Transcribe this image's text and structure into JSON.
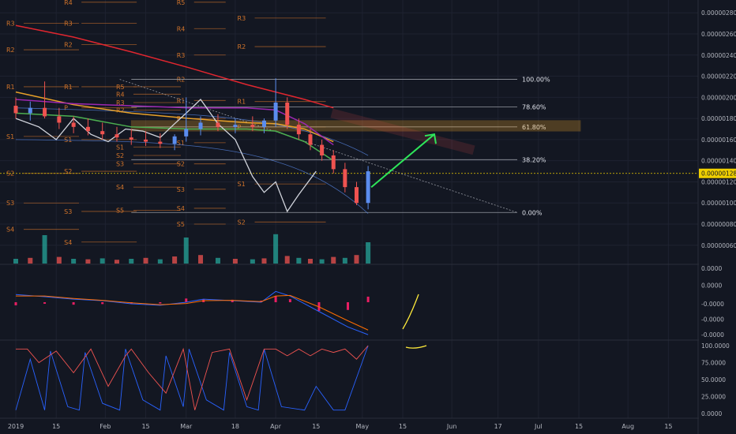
{
  "colors": {
    "background": "#131722",
    "grid": "#1e2230",
    "axis_text": "#b2b5be",
    "pivot": "#d0732a",
    "fib": "#9598a1",
    "bull": "#26a69a",
    "bear": "#ef5350",
    "highlight": "#f0d000",
    "projection": "#2ee65a",
    "ma200": "#e0262f",
    "ma100": "#e8a128",
    "ma50": "#4caf50",
    "ma_purple": "#9c27b0",
    "bollinger": "#5b8def",
    "comparison_line": "#d1d4dc",
    "macd_line": "#2962ff",
    "signal_line": "#ff6d00",
    "hist": "#e91e63",
    "stoch_k": "#2962ff",
    "stoch_d": "#ef5350",
    "drawing_yellow": "#ffeb3b"
  },
  "chart_data": [
    {
      "type": "line",
      "panel": "price",
      "title": "",
      "x_tick_labels": [
        "2019",
        "15",
        "Feb",
        "15",
        "Mar",
        "18",
        "Apr",
        "15",
        "May",
        "15",
        "Jun",
        "17",
        "Jul",
        "15",
        "Aug",
        "15"
      ],
      "x_tick_days": [
        0,
        14,
        31,
        45,
        59,
        76,
        90,
        104,
        120,
        134,
        151,
        167,
        181,
        195,
        212,
        226
      ],
      "y_tick_labels": [
        "0.00000060",
        "0.00000080",
        "0.00000100",
        "0.00000120",
        "0.00000140",
        "0.00000160",
        "0.00000180",
        "0.00000200",
        "0.00000220",
        "0.00000240",
        "0.00000260",
        "0.00000280"
      ],
      "ylim": [
        5e-07,
        2.9e-06
      ],
      "last_price": "0.00000128",
      "fib_levels": [
        {
          "label": "100.00%",
          "value": 2.17e-06
        },
        {
          "label": "78.60%",
          "value": 1.91e-06
        },
        {
          "label": "61.80%",
          "value": 1.72e-06
        },
        {
          "label": "38.20%",
          "value": 1.41e-06
        },
        {
          "label": "0.00%",
          "value": 9.1e-07
        }
      ],
      "pivot_labels": [
        {
          "label": "R4",
          "day": 20,
          "value": 2.9e-06
        },
        {
          "label": "R3",
          "day": 0,
          "value": 2.7e-06
        },
        {
          "label": "R3",
          "day": 20,
          "value": 2.7e-06
        },
        {
          "label": "R2",
          "day": 0,
          "value": 2.45e-06
        },
        {
          "label": "R2",
          "day": 20,
          "value": 2.5e-06
        },
        {
          "label": "R1",
          "day": 0,
          "value": 2.1e-06
        },
        {
          "label": "R1",
          "day": 20,
          "value": 2.1e-06
        },
        {
          "label": "P",
          "day": 20,
          "value": 1.9e-06
        },
        {
          "label": "S1",
          "day": 0,
          "value": 1.63e-06
        },
        {
          "label": "S1",
          "day": 20,
          "value": 1.6e-06
        },
        {
          "label": "S2",
          "day": 0,
          "value": 1.28e-06
        },
        {
          "label": "S2",
          "day": 20,
          "value": 1.3e-06
        },
        {
          "label": "S3",
          "day": 0,
          "value": 1e-06
        },
        {
          "label": "S3",
          "day": 20,
          "value": 9.2e-07
        },
        {
          "label": "S4",
          "day": 0,
          "value": 7.5e-07
        },
        {
          "label": "S4",
          "day": 20,
          "value": 6.3e-07
        },
        {
          "label": "R5",
          "day": 38,
          "value": 2.1e-06
        },
        {
          "label": "R4",
          "day": 38,
          "value": 2.03e-06
        },
        {
          "label": "R3",
          "day": 38,
          "value": 1.95e-06
        },
        {
          "label": "R2",
          "day": 38,
          "value": 1.88e-06
        },
        {
          "label": "S1",
          "day": 38,
          "value": 1.53e-06
        },
        {
          "label": "S2",
          "day": 38,
          "value": 1.45e-06
        },
        {
          "label": "S3",
          "day": 38,
          "value": 1.37e-06
        },
        {
          "label": "S4",
          "day": 38,
          "value": 1.15e-06
        },
        {
          "label": "S5",
          "day": 38,
          "value": 9.3e-07
        },
        {
          "label": "R5",
          "day": 59,
          "value": 2.9e-06
        },
        {
          "label": "R4",
          "day": 59,
          "value": 2.65e-06
        },
        {
          "label": "R3",
          "day": 59,
          "value": 2.4e-06
        },
        {
          "label": "R2",
          "day": 59,
          "value": 2.17e-06
        },
        {
          "label": "R1",
          "day": 59,
          "value": 1.97e-06
        },
        {
          "label": "P",
          "day": 59,
          "value": 1.8e-06
        },
        {
          "label": "S1",
          "day": 59,
          "value": 1.57e-06
        },
        {
          "label": "S2",
          "day": 59,
          "value": 1.37e-06
        },
        {
          "label": "S3",
          "day": 59,
          "value": 1.13e-06
        },
        {
          "label": "S4",
          "day": 59,
          "value": 9.5e-07
        },
        {
          "label": "S5",
          "day": 59,
          "value": 8e-07
        },
        {
          "label": "R3",
          "day": 80,
          "value": 2.75e-06
        },
        {
          "label": "R2",
          "day": 80,
          "value": 2.48e-06
        },
        {
          "label": "R1",
          "day": 80,
          "value": 1.96e-06
        },
        {
          "label": "P",
          "day": 80,
          "value": 1.72e-06
        },
        {
          "label": "S1",
          "day": 80,
          "value": 1.18e-06
        },
        {
          "label": "S2",
          "day": 80,
          "value": 8.2e-07
        }
      ],
      "series": [
        {
          "name": "",
          "kind": "ma",
          "color_key": "ma200",
          "x": [
            0,
            20,
            40,
            60,
            80,
            90,
            100,
            110
          ],
          "y": [
            2.68e-06,
            2.57e-06,
            2.43e-06,
            2.28e-06,
            2.12e-06,
            2.05e-06,
            1.98e-06,
            1.9e-06
          ]
        },
        {
          "name": "",
          "kind": "ma",
          "color_key": "ma100",
          "x": [
            0,
            20,
            40,
            60,
            80,
            90,
            100,
            110
          ],
          "y": [
            2.05e-06,
            1.93e-06,
            1.85e-06,
            1.8e-06,
            1.76e-06,
            1.75e-06,
            1.7e-06,
            1.58e-06
          ]
        },
        {
          "name": "",
          "kind": "ma",
          "color_key": "ma50",
          "x": [
            0,
            20,
            40,
            60,
            80,
            90,
            100,
            110
          ],
          "y": [
            1.85e-06,
            1.82e-06,
            1.72e-06,
            1.7e-06,
            1.7e-06,
            1.68e-06,
            1.58e-06,
            1.4e-06
          ]
        },
        {
          "name": "",
          "kind": "ma",
          "color_key": "ma_purple",
          "x": [
            0,
            20,
            40,
            60,
            80,
            90,
            100,
            110
          ],
          "y": [
            1.98e-06,
            1.94e-06,
            1.92e-06,
            1.9e-06,
            1.9e-06,
            1.88e-06,
            1.75e-06,
            1.55e-06
          ]
        },
        {
          "name": "",
          "kind": "comparison",
          "color_key": "comparison_line",
          "x": [
            0,
            8,
            14,
            20,
            26,
            32,
            38,
            44,
            50,
            55,
            59,
            64,
            70,
            76,
            82,
            86,
            90,
            94,
            98,
            104
          ],
          "y": [
            1.8e-06,
            1.72e-06,
            1.6e-06,
            1.8e-06,
            1.65e-06,
            1.58e-06,
            1.7e-06,
            1.68e-06,
            1.62e-06,
            1.75e-06,
            1.85e-06,
            1.98e-06,
            1.75e-06,
            1.6e-06,
            1.25e-06,
            1.1e-06,
            1.2e-06,
            9.2e-07,
            1.08e-06,
            1.3e-06
          ]
        }
      ],
      "candles_ohlc_by_day": [
        [
          0,
          1.92e-06,
          2e-06,
          1.8e-06,
          1.85e-06
        ],
        [
          5,
          1.85e-06,
          1.96e-06,
          1.78e-06,
          1.9e-06
        ],
        [
          10,
          1.9e-06,
          2.15e-06,
          1.8e-06,
          1.82e-06
        ],
        [
          15,
          1.82e-06,
          1.9e-06,
          1.7e-06,
          1.76e-06
        ],
        [
          20,
          1.76e-06,
          1.82e-06,
          1.66e-06,
          1.72e-06
        ],
        [
          25,
          1.72e-06,
          1.8e-06,
          1.64e-06,
          1.68e-06
        ],
        [
          30,
          1.68e-06,
          1.76e-06,
          1.6e-06,
          1.65e-06
        ],
        [
          35,
          1.65e-06,
          1.72e-06,
          1.58e-06,
          1.62e-06
        ],
        [
          40,
          1.62e-06,
          1.7e-06,
          1.55e-06,
          1.6e-06
        ],
        [
          45,
          1.6e-06,
          1.68e-06,
          1.54e-06,
          1.58e-06
        ],
        [
          50,
          1.58e-06,
          1.66e-06,
          1.52e-06,
          1.56e-06
        ],
        [
          55,
          1.56e-06,
          1.65e-06,
          1.5e-06,
          1.63e-06
        ],
        [
          59,
          1.63e-06,
          2e-06,
          1.58e-06,
          1.7e-06
        ],
        [
          64,
          1.7e-06,
          1.82e-06,
          1.64e-06,
          1.76e-06
        ],
        [
          70,
          1.76e-06,
          1.84e-06,
          1.68e-06,
          1.72e-06
        ],
        [
          76,
          1.72e-06,
          1.8e-06,
          1.66e-06,
          1.74e-06
        ],
        [
          82,
          1.74e-06,
          1.82e-06,
          1.68e-06,
          1.72e-06
        ],
        [
          86,
          1.72e-06,
          1.8e-06,
          1.66e-06,
          1.78e-06
        ],
        [
          90,
          1.78e-06,
          2.18e-06,
          1.72e-06,
          1.95e-06
        ],
        [
          94,
          1.95e-06,
          2e-06,
          1.7e-06,
          1.74e-06
        ],
        [
          98,
          1.74e-06,
          1.8e-06,
          1.6e-06,
          1.65e-06
        ],
        [
          102,
          1.65e-06,
          1.7e-06,
          1.5e-06,
          1.55e-06
        ],
        [
          106,
          1.55e-06,
          1.6e-06,
          1.4e-06,
          1.45e-06
        ],
        [
          110,
          1.45e-06,
          1.5e-06,
          1.28e-06,
          1.32e-06
        ],
        [
          114,
          1.32e-06,
          1.38e-06,
          1.1e-06,
          1.15e-06
        ],
        [
          118,
          1.15e-06,
          1.2e-06,
          9.8e-07,
          1e-06
        ],
        [
          122,
          1e-06,
          1.35e-06,
          9.4e-07,
          1.3e-06
        ]
      ],
      "volume_by_day": [
        [
          0,
          10
        ],
        [
          5,
          12
        ],
        [
          10,
          60
        ],
        [
          15,
          14
        ],
        [
          20,
          10
        ],
        [
          25,
          9
        ],
        [
          30,
          11
        ],
        [
          35,
          8
        ],
        [
          40,
          10
        ],
        [
          45,
          12
        ],
        [
          50,
          9
        ],
        [
          55,
          15
        ],
        [
          59,
          55
        ],
        [
          64,
          18
        ],
        [
          70,
          12
        ],
        [
          76,
          10
        ],
        [
          82,
          9
        ],
        [
          86,
          11
        ],
        [
          90,
          62
        ],
        [
          94,
          16
        ],
        [
          98,
          12
        ],
        [
          102,
          10
        ],
        [
          106,
          9
        ],
        [
          110,
          14
        ],
        [
          114,
          12
        ],
        [
          118,
          18
        ],
        [
          122,
          45
        ]
      ],
      "projection_target": 1.65e-06
    },
    {
      "type": "line",
      "panel": "macd",
      "y_tick_labels": [
        "0.0000",
        "0.0000",
        "-0.0000",
        "-0.0000",
        "-0.0000"
      ],
      "ylim": [
        -1.2,
        1.2
      ],
      "series": [
        {
          "name": "",
          "color_key": "macd_line",
          "x": [
            0,
            10,
            20,
            30,
            40,
            50,
            59,
            65,
            75,
            85,
            90,
            95,
            105,
            115,
            122
          ],
          "y": [
            0.25,
            0.18,
            0.1,
            0.05,
            -0.05,
            -0.1,
            0.0,
            0.1,
            0.05,
            0.0,
            0.35,
            0.2,
            -0.3,
            -0.8,
            -1.05
          ]
        },
        {
          "name": "",
          "color_key": "signal_line",
          "x": [
            0,
            10,
            20,
            30,
            40,
            50,
            59,
            65,
            75,
            85,
            90,
            95,
            105,
            115,
            122
          ],
          "y": [
            0.2,
            0.2,
            0.12,
            0.06,
            -0.02,
            -0.08,
            -0.04,
            0.05,
            0.06,
            0.02,
            0.2,
            0.22,
            -0.15,
            -0.6,
            -0.9
          ]
        }
      ],
      "histogram": [
        [
          0,
          -0.1
        ],
        [
          10,
          -0.05
        ],
        [
          20,
          -0.08
        ],
        [
          30,
          -0.06
        ],
        [
          40,
          -0.05
        ],
        [
          50,
          -0.04
        ],
        [
          59,
          0.12
        ],
        [
          65,
          0.1
        ],
        [
          75,
          0.08
        ],
        [
          85,
          0.05
        ],
        [
          90,
          0.2
        ],
        [
          95,
          0.1
        ],
        [
          105,
          -0.28
        ],
        [
          115,
          -0.25
        ],
        [
          122,
          0.18
        ]
      ]
    },
    {
      "type": "line",
      "panel": "stochastic",
      "y_tick_labels": [
        "100.0000",
        "75.0000",
        "50.0000",
        "25.0000",
        "0.0000"
      ],
      "ylim": [
        0,
        100
      ],
      "series": [
        {
          "name": "",
          "color_key": "stoch_k",
          "x": [
            0,
            5,
            10,
            12,
            18,
            22,
            24,
            30,
            36,
            38,
            44,
            50,
            52,
            58,
            60,
            66,
            72,
            74,
            80,
            84,
            86,
            92,
            100,
            104,
            110,
            114,
            122
          ],
          "y": [
            5,
            80,
            5,
            92,
            10,
            5,
            90,
            15,
            5,
            95,
            20,
            5,
            85,
            10,
            95,
            20,
            5,
            90,
            10,
            5,
            95,
            10,
            5,
            40,
            5,
            5,
            100
          ]
        },
        {
          "name": "",
          "color_key": "stoch_d",
          "x": [
            0,
            4,
            8,
            14,
            20,
            26,
            32,
            38,
            40,
            46,
            52,
            58,
            62,
            68,
            74,
            80,
            86,
            90,
            94,
            98,
            102,
            106,
            110,
            114,
            118,
            122
          ],
          "y": [
            95,
            95,
            75,
            92,
            60,
            95,
            40,
            85,
            95,
            60,
            30,
            95,
            5,
            90,
            95,
            20,
            95,
            95,
            85,
            95,
            85,
            95,
            90,
            95,
            80,
            100
          ]
        }
      ]
    }
  ]
}
